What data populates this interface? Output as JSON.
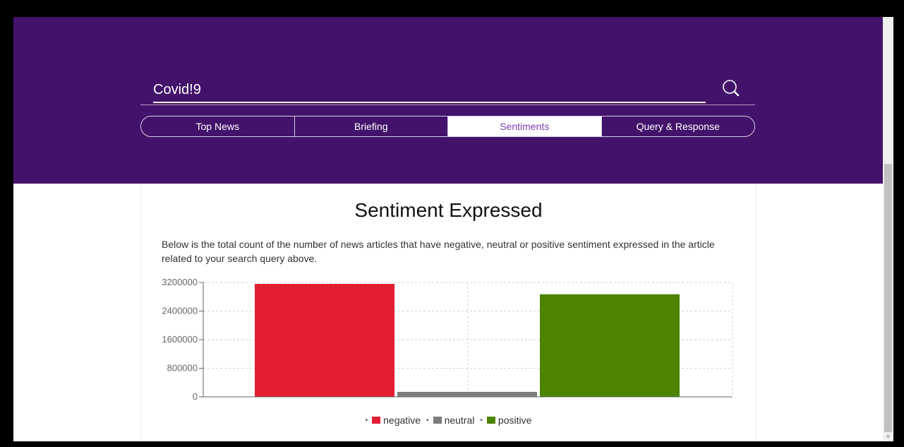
{
  "search": {
    "value": "Covid!9"
  },
  "tabs": [
    "Top News",
    "Briefing",
    "Sentiments",
    "Query & Response"
  ],
  "active_tab": 2,
  "section": {
    "title": "Sentiment Expressed",
    "description": "Below is the total count of the number of news articles that have negative, neutral or positive sentiment expressed in the article related to your search query above."
  },
  "colors": {
    "header": "#43136b",
    "negative": "#e41e32",
    "neutral": "#7c7c7c",
    "positive": "#4b8500"
  },
  "chart_data": {
    "type": "bar",
    "categories": [
      "negative",
      "neutral",
      "positive"
    ],
    "values": [
      3160000,
      140000,
      2870000
    ],
    "series_colors": [
      "#e41e32",
      "#7c7c7c",
      "#4b8500"
    ],
    "yticks": [
      "0",
      "800000",
      "1600000",
      "2400000",
      "3200000"
    ],
    "yticks_displayed": [
      "0",
      "800000",
      "1600000",
      "2400000",
      "3200000"
    ],
    "ylim": [
      0,
      3200000
    ],
    "grid": true,
    "legend": "bottom-center"
  }
}
